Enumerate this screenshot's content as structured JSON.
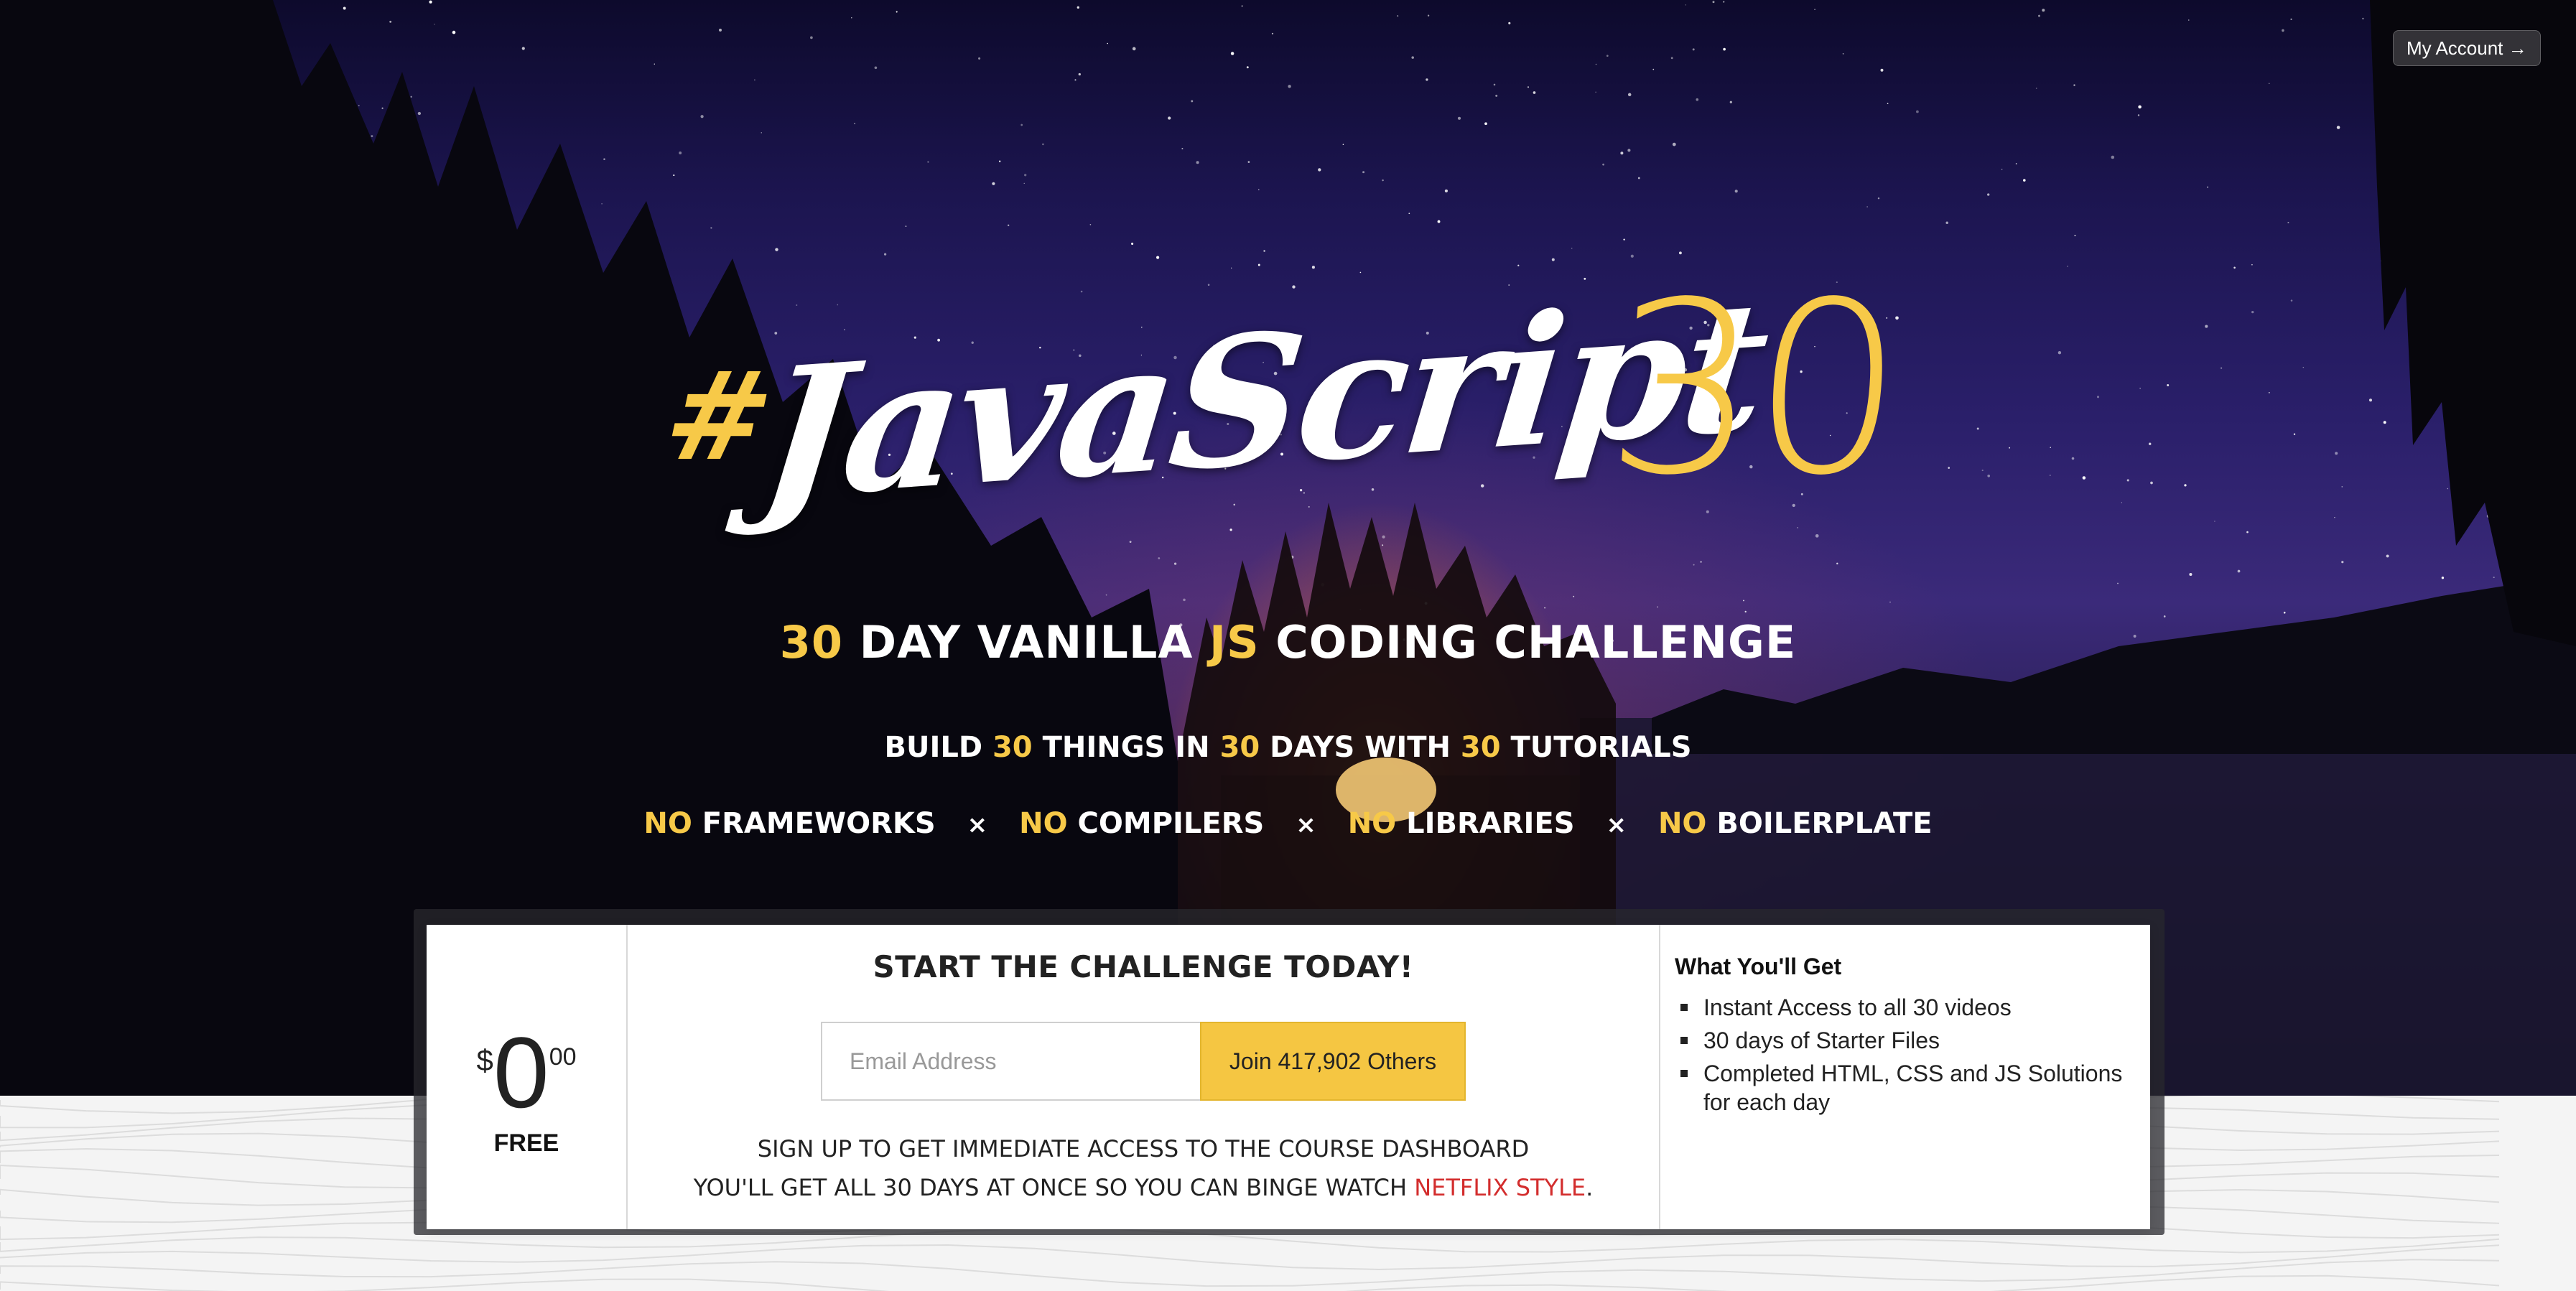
{
  "header": {
    "account_label": "My Account →"
  },
  "logo": {
    "hash": "#",
    "word": "JavaScript",
    "number": "30"
  },
  "tagline": {
    "num": "30",
    "day": "Day Vanilla",
    "js": "JS",
    "rest": "Coding Challenge"
  },
  "subline": {
    "w1": "Build",
    "n1": "30",
    "w2": "things in",
    "n2": "30",
    "w3": "days with",
    "n3": "30",
    "w4": "tutorials"
  },
  "no_items": [
    {
      "no": "No",
      "label": "Frameworks"
    },
    {
      "no": "No",
      "label": "Compilers"
    },
    {
      "no": "No",
      "label": "Libraries"
    },
    {
      "no": "No",
      "label": "Boilerplate"
    }
  ],
  "separator": "×",
  "price": {
    "currency": "$",
    "amount": "0",
    "cents": "00",
    "label": "FREE"
  },
  "signup": {
    "title": "Start the challenge today!",
    "email_placeholder": "Email Address",
    "button_label": "Join 417,902 Others",
    "note_line1": "Sign up to get immediate access to the course dashboard",
    "note_line2_prefix": "You'll get all 30 days at once so you can binge watch",
    "note_line2_highlight": "Netflix style",
    "note_line2_suffix": "."
  },
  "benefits": {
    "title": "What You'll Get",
    "items": [
      "Instant Access to all 30 videos",
      "30 days of Starter Files",
      "Completed HTML, CSS and JS Solutions for each day"
    ]
  },
  "colors": {
    "accent": "#f7c948",
    "button": "#f5c642",
    "netflix_red": "#d32d2d"
  }
}
